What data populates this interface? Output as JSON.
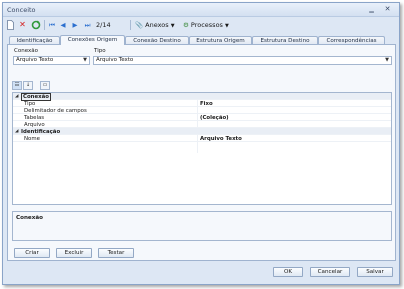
{
  "window": {
    "title": "Conceito"
  },
  "toolbar": {
    "counter": "2/14",
    "anexos_label": "Anexos",
    "processos_label": "Processos"
  },
  "tabs": [
    {
      "label": "Identificação"
    },
    {
      "label": "Conexões Origem"
    },
    {
      "label": "Conexão Destino"
    },
    {
      "label": "Estrutura Origem"
    },
    {
      "label": "Estrutura Destino"
    },
    {
      "label": "Correspondências"
    }
  ],
  "form": {
    "conexao_label": "Conexão",
    "conexao_value": "Arquivo Texto",
    "tipo_label": "Tipo",
    "tipo_value": "Arquivo Texto"
  },
  "grid": {
    "categories": [
      {
        "name": "Conexão",
        "rows": [
          {
            "key": "Tipo",
            "value": "Fixo"
          },
          {
            "key": "Delimitador de campos",
            "value": ""
          },
          {
            "key": "Tabelas",
            "value": "(Coleção)"
          },
          {
            "key": "Arquivo",
            "value": ""
          }
        ]
      },
      {
        "name": "Identificação",
        "rows": [
          {
            "key": "Nome",
            "value": "Arquivo Texto"
          }
        ]
      }
    ]
  },
  "description": {
    "title": "Conexão"
  },
  "buttons": {
    "criar": "Criar",
    "excluir": "Excluir",
    "testar": "Testar",
    "ok": "OK",
    "cancelar": "Cancelar",
    "salvar": "Salvar"
  }
}
